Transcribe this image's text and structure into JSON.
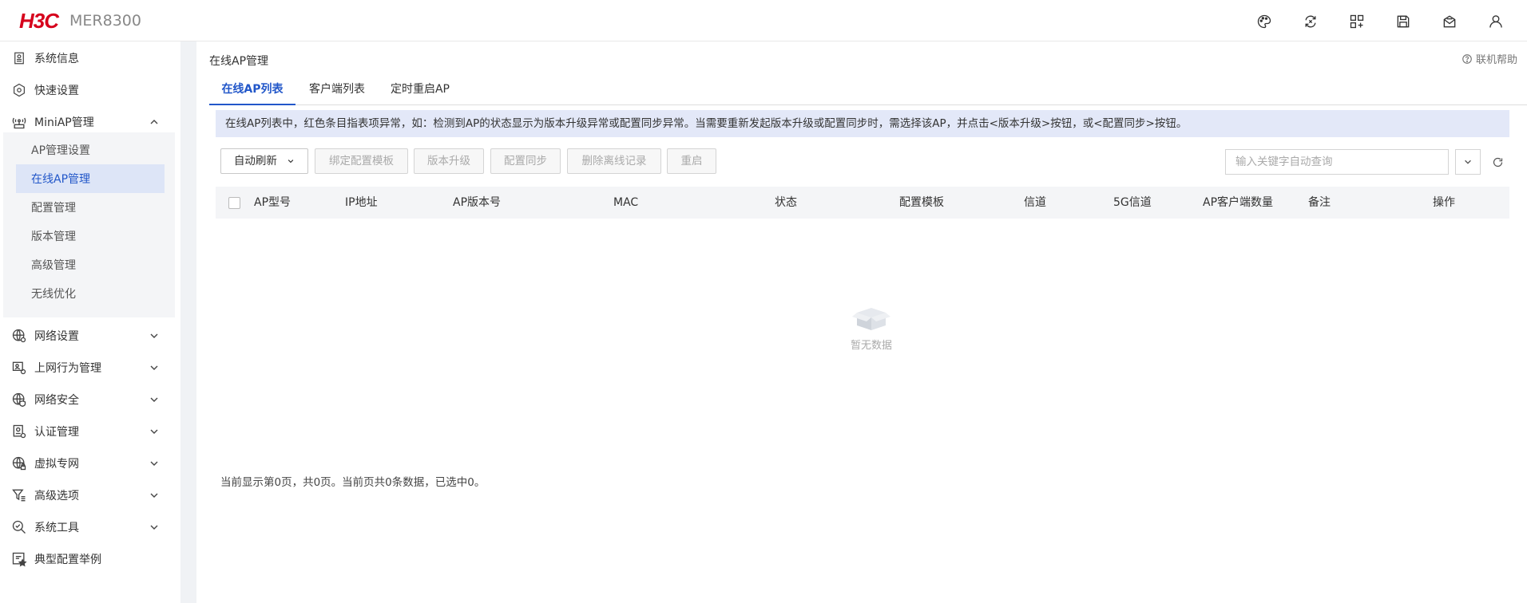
{
  "header": {
    "brand": "H3C",
    "model": "MER8300",
    "icons": [
      "palette-icon",
      "sync-icon",
      "apps-icon",
      "save-icon",
      "mail-icon",
      "user-icon"
    ]
  },
  "sidebar": {
    "items": [
      {
        "label": "系统信息",
        "icon": "info-icon"
      },
      {
        "label": "快速设置",
        "icon": "settings-icon"
      },
      {
        "label": "MiniAP管理",
        "icon": "antenna-icon",
        "expanded": true
      },
      {
        "label": "网络设置",
        "icon": "globe-gear-icon"
      },
      {
        "label": "上网行为管理",
        "icon": "monitor-icon"
      },
      {
        "label": "网络安全",
        "icon": "globe-shield-icon"
      },
      {
        "label": "认证管理",
        "icon": "id-card-icon"
      },
      {
        "label": "虚拟专网",
        "icon": "globe-lock-icon"
      },
      {
        "label": "高级选项",
        "icon": "filter-icon"
      },
      {
        "label": "系统工具",
        "icon": "wrench-icon"
      },
      {
        "label": "典型配置举例",
        "icon": "star-doc-icon"
      }
    ],
    "submenu": [
      {
        "label": "AP管理设置"
      },
      {
        "label": "在线AP管理",
        "active": true
      },
      {
        "label": "配置管理"
      },
      {
        "label": "版本管理"
      },
      {
        "label": "高级管理"
      },
      {
        "label": "无线优化"
      }
    ]
  },
  "content": {
    "page_title": "在线AP管理",
    "help_label": "联机帮助",
    "tabs": [
      {
        "label": "在线AP列表",
        "active": true
      },
      {
        "label": "客户端列表"
      },
      {
        "label": "定时重启AP"
      }
    ],
    "notice": "在线AP列表中，红色条目指表项异常，如：检测到AP的状态显示为版本升级异常或配置同步异常。当需要重新发起版本升级或配置同步时，需选择该AP，并点击<版本升级>按钮，或<配置同步>按钮。",
    "toolbar": {
      "auto_refresh": "自动刷新",
      "bind_template": "绑定配置模板",
      "upgrade": "版本升级",
      "config_sync": "配置同步",
      "delete_offline": "删除离线记录",
      "reboot": "重启",
      "search_placeholder": "输入关键字自动查询"
    },
    "table": {
      "columns": [
        "AP型号",
        "IP地址",
        "AP版本号",
        "MAC",
        "状态",
        "配置模板",
        "信道",
        "5G信道",
        "AP客户端数量",
        "备注",
        "操作"
      ],
      "rows": [],
      "empty_text": "暂无数据"
    },
    "pager_text": "当前显示第0页，共0页。当前页共0条数据，已选中0。"
  },
  "colors": {
    "brand_red": "#d6001c",
    "accent_blue": "#2257c9",
    "notice_bg": "#e3e8f8"
  }
}
